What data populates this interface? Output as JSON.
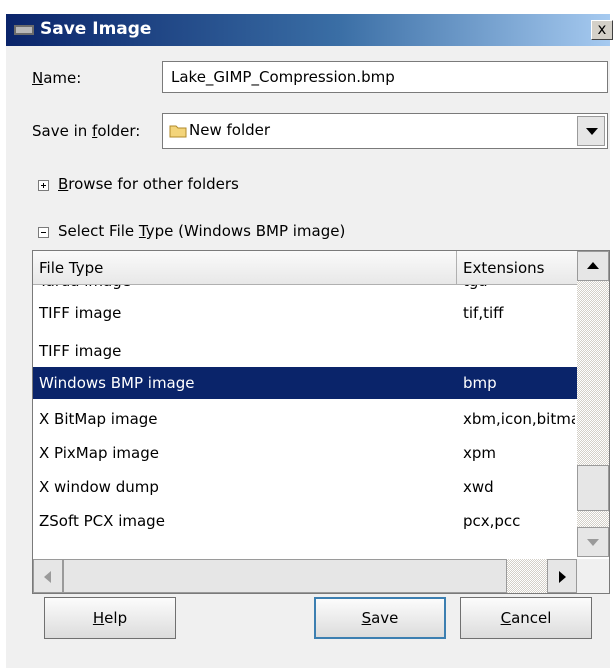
{
  "window": {
    "title": "Save Image",
    "close_glyph": "x",
    "icon": "gimp-wilber-icon"
  },
  "name_field": {
    "label_accel": "N",
    "label_rest": "ame:",
    "value": "Lake_GIMP_Compression.bmp"
  },
  "folder_field": {
    "label_pre": "Save in ",
    "label_accel": "f",
    "label_post": "older:",
    "value": "New folder",
    "icon": "folder-icon"
  },
  "browse": {
    "accel": "B",
    "rest": "rowse for other folders",
    "expanded": false
  },
  "select_type": {
    "pre": "Select File ",
    "accel": "T",
    "post": "ype (Windows BMP image)",
    "expanded": true
  },
  "file_type_list": {
    "columns": [
      "File Type",
      "Extensions"
    ],
    "partial_row_top": {
      "type": "Tarda image",
      "ext": "tga"
    },
    "rows": [
      {
        "type": "TIFF image",
        "ext": "tif,tiff",
        "selected": false
      },
      {
        "type": "TIFF image",
        "ext": "",
        "selected": false
      },
      {
        "type": "Windows BMP image",
        "ext": "bmp",
        "selected": true
      },
      {
        "type": "X BitMap image",
        "ext": "xbm,icon,bitmap",
        "selected": false
      },
      {
        "type": "X PixMap image",
        "ext": "xpm",
        "selected": false
      },
      {
        "type": "X window dump",
        "ext": "xwd",
        "selected": false
      },
      {
        "type": "ZSoft PCX image",
        "ext": "pcx,pcc",
        "selected": false
      }
    ]
  },
  "buttons": {
    "help": {
      "accel": "H",
      "rest": "elp"
    },
    "save": {
      "accel": "S",
      "rest": "ave"
    },
    "cancel": {
      "accel": "C",
      "rest": "ancel"
    }
  },
  "colors": {
    "selection": "#0a246a",
    "dialog_bg": "#f0f0f0"
  }
}
